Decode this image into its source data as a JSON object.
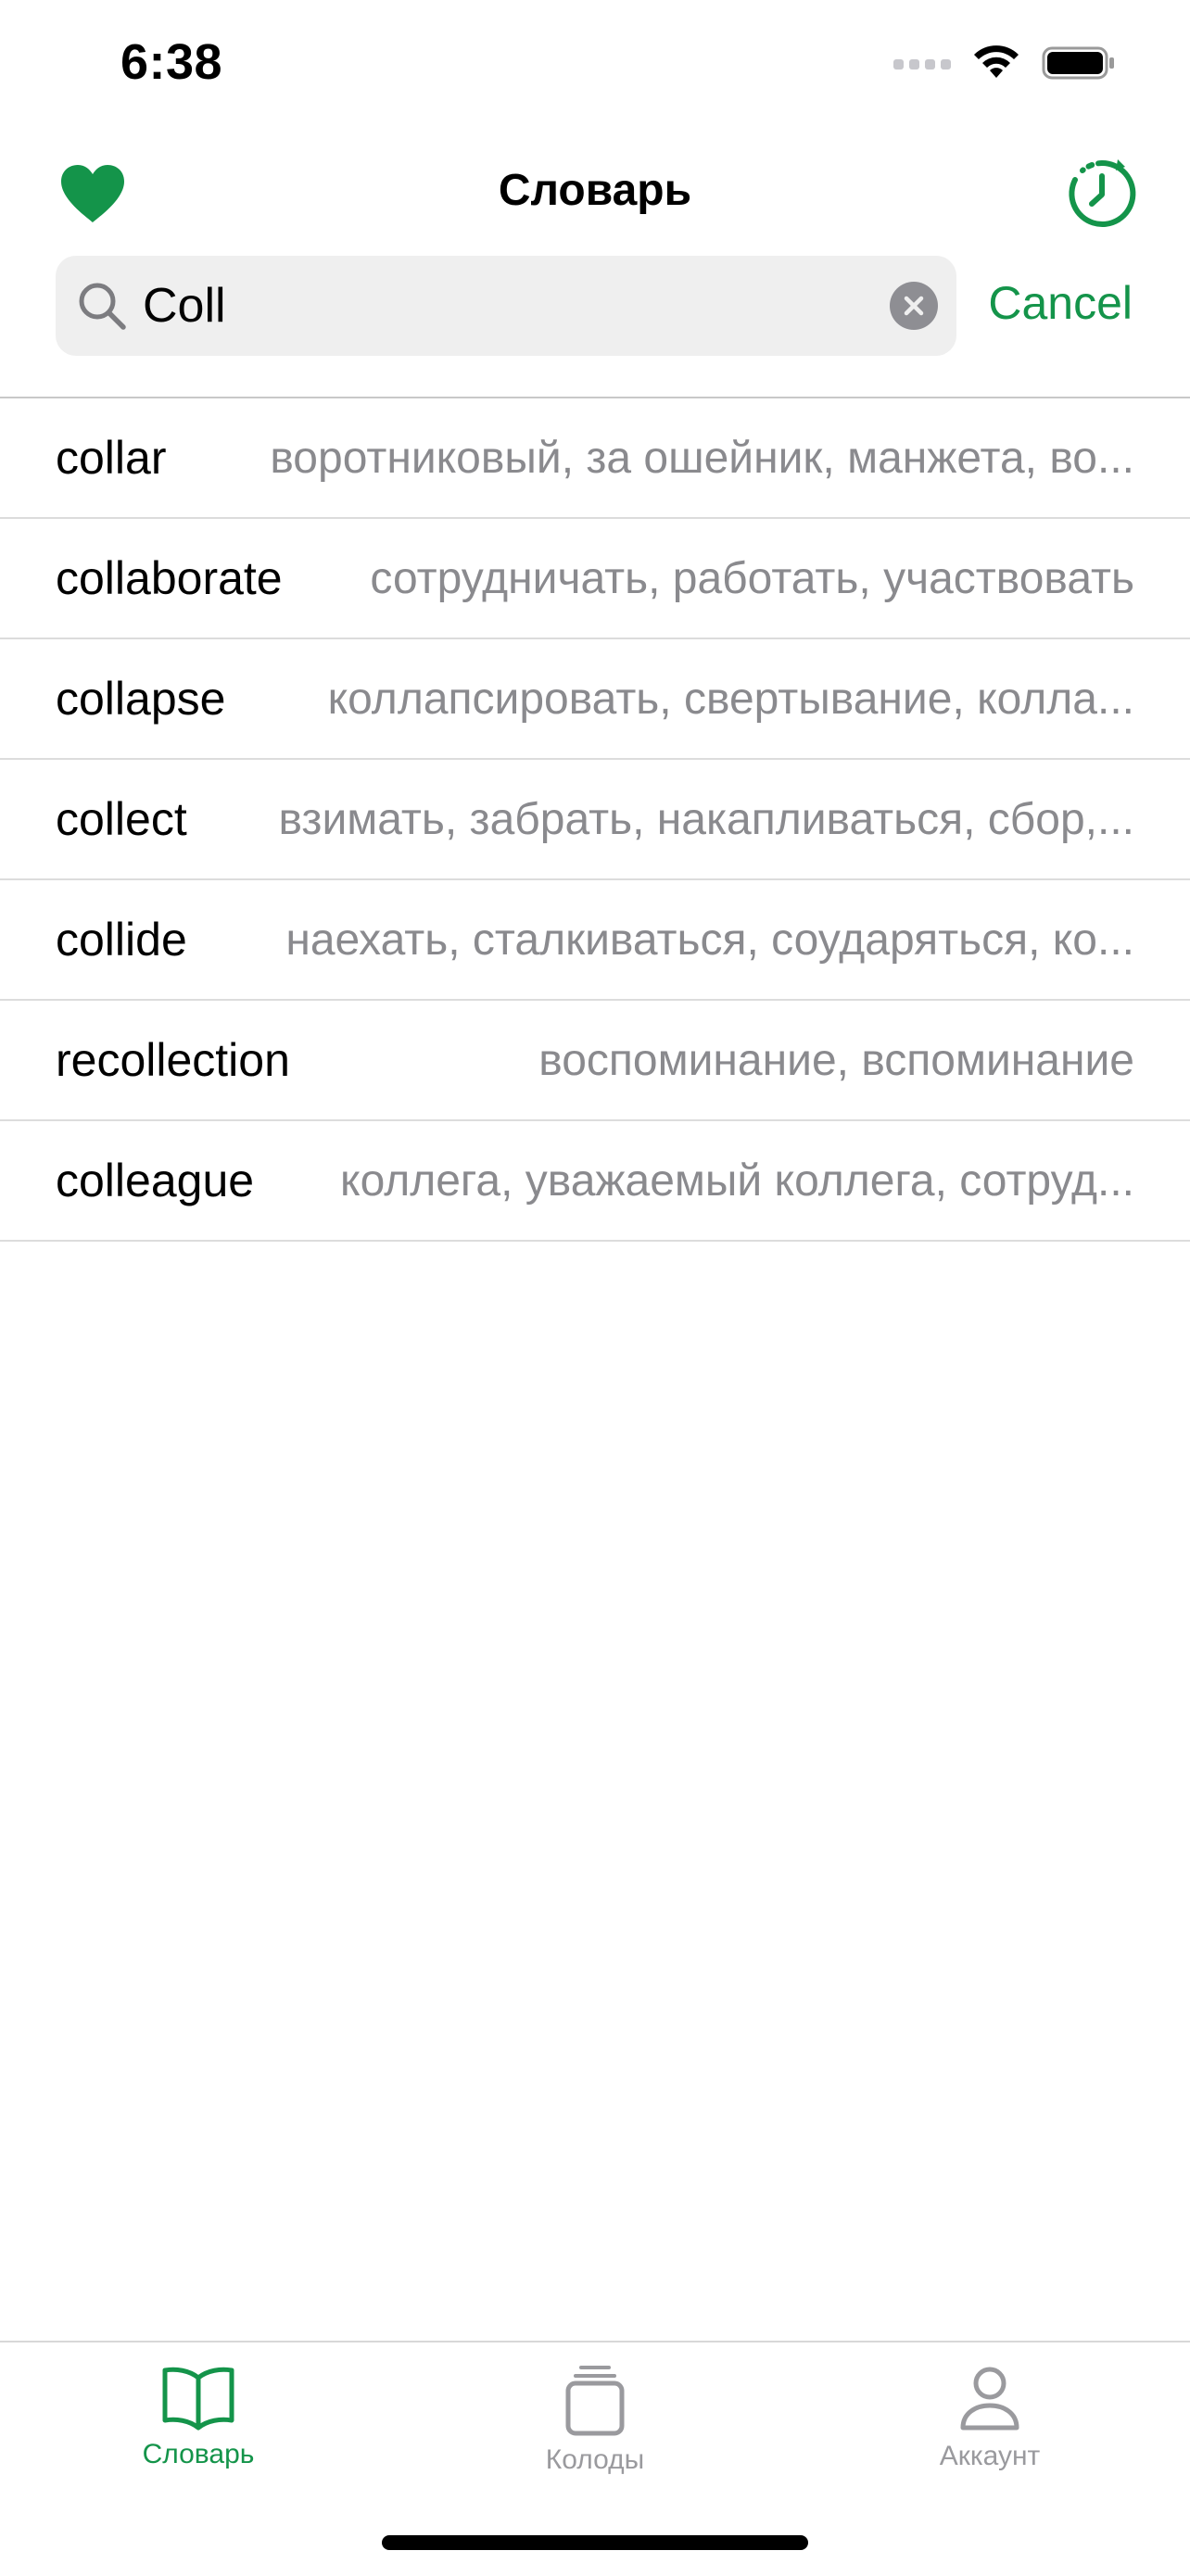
{
  "status_bar": {
    "time": "6:38",
    "icons": [
      "signal-icon",
      "wifi-icon",
      "battery-icon"
    ]
  },
  "nav": {
    "title": "Словарь",
    "left_icon": "heart-icon",
    "right_icon": "history-clock-icon"
  },
  "search": {
    "value": "Coll",
    "placeholder": "",
    "cancel_label": "Cancel"
  },
  "results": [
    {
      "word": "collar",
      "translation": "воротниковый, за ошейник, манжета, во..."
    },
    {
      "word": "collaborate",
      "translation": "сотрудничать, работать, участвовать"
    },
    {
      "word": "collapse",
      "translation": "коллапсировать, свертывание, колла..."
    },
    {
      "word": "collect",
      "translation": "взимать, забрать, накапливаться, сбор,..."
    },
    {
      "word": "collide",
      "translation": "наехать, сталкиваться, соударяться, ко..."
    },
    {
      "word": "recollection",
      "translation": "воспоминание, вспоминание"
    },
    {
      "word": "colleague",
      "translation": "коллега, уважаемый коллега, сотруд..."
    }
  ],
  "tabs": [
    {
      "label": "Словарь",
      "icon": "book-icon",
      "active": true
    },
    {
      "label": "Колоды",
      "icon": "cards-stack-icon",
      "active": false
    },
    {
      "label": "Аккаунт",
      "icon": "person-icon",
      "active": false
    }
  ],
  "colors": {
    "accent": "#14944a",
    "secondary_text": "#8a8a8e",
    "search_background": "#efefef"
  }
}
